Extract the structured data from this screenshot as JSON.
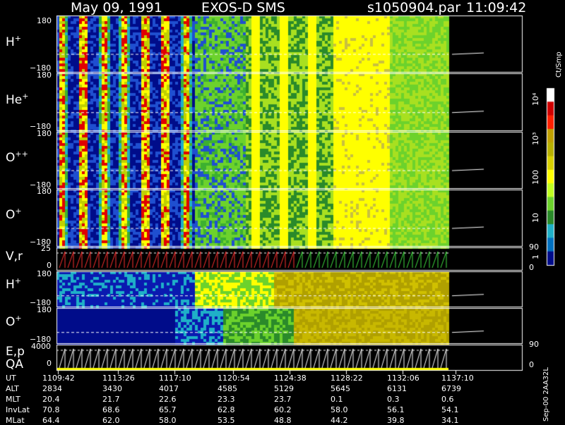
{
  "header": {
    "date": "May 09, 1991",
    "mission": "EXOS-D SMS",
    "file": "s1050904.par",
    "time": "11:09:42"
  },
  "panels": [
    {
      "label": "H",
      "sup": "+",
      "top_tick": "180",
      "bottom_tick": "−180"
    },
    {
      "label": "He",
      "sup": "+",
      "top_tick": "180",
      "bottom_tick": "−180"
    },
    {
      "label": "O",
      "sup": "++",
      "top_tick": "180",
      "bottom_tick": "−180"
    },
    {
      "label": "O",
      "sup": "+",
      "top_tick": "180",
      "bottom_tick": "−180"
    },
    {
      "label": "V,r",
      "sup": "",
      "top_tick": "25",
      "bottom_tick": "0",
      "right_top": "90",
      "right_bottom": "0"
    },
    {
      "label": "H",
      "sup": "+",
      "top_tick": "180",
      "bottom_tick": "−180"
    },
    {
      "label": "O",
      "sup": "+",
      "top_tick": "180",
      "bottom_tick": "−180"
    },
    {
      "label": "E,p",
      "sub_label": "QA",
      "top_tick": "4000",
      "bottom_tick": "0",
      "right_top": "90",
      "right_bottom": "0"
    }
  ],
  "colorbar": {
    "unit_label": "Ct/Smp",
    "ticks": [
      "10⁴",
      "10³",
      "100",
      "10",
      "1"
    ]
  },
  "footer": {
    "rows": [
      {
        "label": "UT",
        "values": [
          "1109:42",
          "1113:26",
          "1117:10",
          "1120:54",
          "1124:38",
          "1128:22",
          "1132:06",
          "1137:10"
        ]
      },
      {
        "label": "ALT",
        "values": [
          "2834",
          "3430",
          "4017",
          "4585",
          "5129",
          "5645",
          "6131",
          "6739"
        ]
      },
      {
        "label": "MLT",
        "values": [
          "20.4",
          "21.7",
          "22.6",
          "23.3",
          "23.7",
          "0.1",
          "0.3",
          "0.6"
        ]
      },
      {
        "label": "InvLat",
        "values": [
          "70.8",
          "68.6",
          "65.7",
          "62.8",
          "60.2",
          "58.0",
          "56.1",
          "54.1"
        ]
      },
      {
        "label": "MLat",
        "values": [
          "64.4",
          "62.0",
          "58.0",
          "53.5",
          "48.8",
          "44.2",
          "39.8",
          "34.1"
        ]
      }
    ],
    "stamp": "Sep-00 2AA32L"
  },
  "chart_data": {
    "type": "heatmap",
    "title": "May 09, 1991   EXOS-D SMS",
    "x_ticks": [
      "1109:42",
      "1113:26",
      "1117:10",
      "1120:54",
      "1124:38",
      "1128:22",
      "1132:06",
      "1137:10"
    ],
    "panels": [
      "H+",
      "He+",
      "O++",
      "O+",
      "V,r",
      "H+",
      "O+",
      "E,p QA"
    ],
    "pitch_angle_range": [
      -180,
      180
    ],
    "colorscale": "log",
    "colorbar_ticks": [
      "1",
      "10",
      "100",
      "10³",
      "10⁴"
    ],
    "colorbar_unit": "Ct/Smp"
  }
}
